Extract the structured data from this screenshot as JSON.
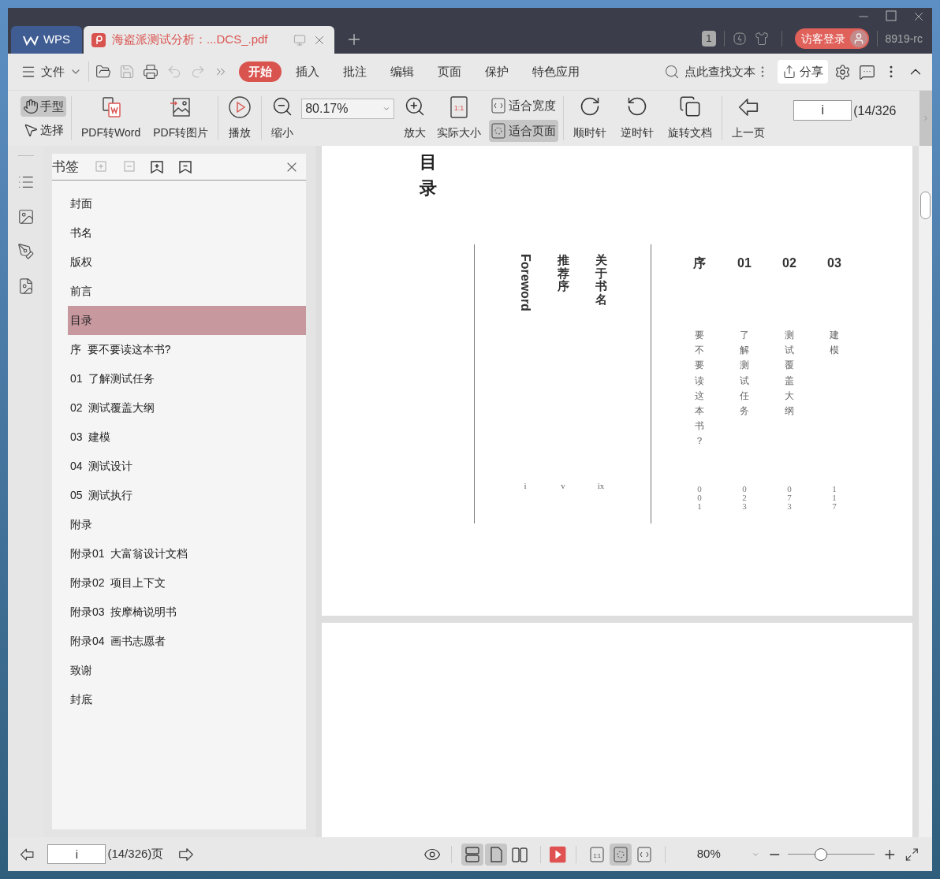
{
  "tabs": [
    {
      "kind": "home",
      "label": "WPS",
      "selected": false
    },
    {
      "kind": "document",
      "label": "海盗派测试分析：...DCS_.pdf",
      "selected": true
    }
  ],
  "title_bar": {
    "badge": "1",
    "login_button": "访客登录",
    "user": "8919-rc"
  },
  "menu": {
    "file": "文件",
    "tabs": [
      {
        "label": "开始",
        "selected": true
      },
      {
        "label": "插入",
        "selected": false
      },
      {
        "label": "批注",
        "selected": false
      },
      {
        "label": "编辑",
        "selected": false
      },
      {
        "label": "页面",
        "selected": false
      },
      {
        "label": "保护",
        "selected": false
      },
      {
        "label": "特色应用",
        "selected": false
      }
    ],
    "search": {
      "placeholder": "点此查找文本"
    },
    "share": "分享"
  },
  "toolbar": {
    "modes": [
      {
        "kind": "hand",
        "label": "手型",
        "selected": true
      },
      {
        "kind": "select",
        "label": "选择",
        "selected": false
      }
    ],
    "left_buttons": [
      {
        "kind": "to-word",
        "label": "PDF转Word"
      },
      {
        "kind": "to-image",
        "label": "PDF转图片"
      },
      {
        "kind": "play",
        "label": "播放"
      },
      {
        "kind": "zoom-out",
        "label": "缩小"
      }
    ],
    "zoom": "80.17%",
    "mid_buttons": [
      {
        "kind": "zoom-in",
        "label": "放大"
      },
      {
        "kind": "actual",
        "label": "实际大小",
        "icon_text": "1:1"
      }
    ],
    "fit": [
      {
        "kind": "width",
        "label": "适合宽度",
        "selected": false
      },
      {
        "kind": "page",
        "label": "适合页面",
        "selected": true
      }
    ],
    "right_buttons": [
      {
        "kind": "cw",
        "label": "顺时针"
      },
      {
        "kind": "ccw",
        "label": "逆时针"
      },
      {
        "kind": "rotate",
        "label": "旋转文档"
      },
      {
        "kind": "prev",
        "label": "上一页"
      }
    ],
    "page_field": "i",
    "page_count": "(14/326"
  },
  "sidebar": {
    "title": "书签",
    "bookmarks": [
      {
        "label": "封面",
        "selected": false
      },
      {
        "label": "书名",
        "selected": false
      },
      {
        "label": "版权",
        "selected": false
      },
      {
        "label": "前言",
        "selected": false
      },
      {
        "label": "目录",
        "selected": true
      },
      {
        "label": "序  要不要读这本书?",
        "selected": false
      },
      {
        "label": "01  了解测试任务",
        "selected": false
      },
      {
        "label": "02  测试覆盖大纲",
        "selected": false
      },
      {
        "label": "03  建模",
        "selected": false
      },
      {
        "label": "04  测试设计",
        "selected": false
      },
      {
        "label": "05  测试执行",
        "selected": false
      },
      {
        "label": "附录",
        "selected": false
      },
      {
        "label": "附录01  大富翁设计文档",
        "selected": false
      },
      {
        "label": "附录02  项目上下文",
        "selected": false
      },
      {
        "label": "附录03  按摩椅说明书",
        "selected": false
      },
      {
        "label": "附录04  画书志愿者",
        "selected": false
      },
      {
        "label": "致谢",
        "selected": false
      },
      {
        "label": "封底",
        "selected": false
      }
    ]
  },
  "document": {
    "heading": "目录",
    "front": [
      {
        "kind": "latin",
        "title": "Foreword",
        "page": "i"
      },
      {
        "kind": "cjk",
        "title": "推荐序",
        "page": "v"
      },
      {
        "kind": "cjk",
        "title": "关于书名",
        "page": "ix"
      }
    ],
    "chapters": [
      {
        "number": "序",
        "title": "要不要读这本书？",
        "page": "001"
      },
      {
        "number": "01",
        "title": "了解测试任务",
        "page": "023"
      },
      {
        "number": "02",
        "title": "测试覆盖大纲",
        "page": "073"
      },
      {
        "number": "03",
        "title": "建模",
        "page": "117"
      }
    ]
  },
  "status_bar": {
    "page_field": "i",
    "page_count": "(14/326)页",
    "view_modes": [
      {
        "kind": "continuous",
        "selected": true
      },
      {
        "kind": "single",
        "selected": true
      },
      {
        "kind": "double",
        "selected": false
      }
    ],
    "fit_modes": [
      {
        "kind": "actual",
        "selected": false,
        "icon_text": "1:1"
      },
      {
        "kind": "page",
        "selected": true
      },
      {
        "kind": "width",
        "selected": false
      }
    ],
    "zoom": "80%",
    "level": 0.38
  }
}
